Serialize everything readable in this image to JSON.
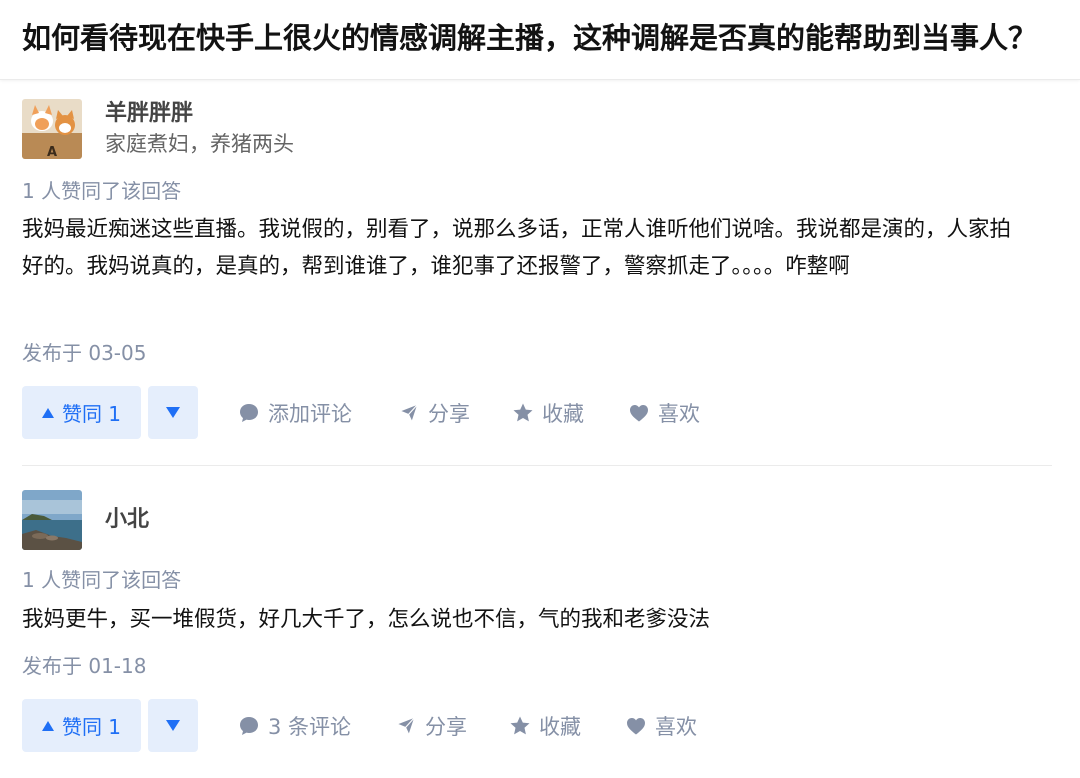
{
  "question": {
    "title": "如何看待现在快手上很火的情感调解主播，这种调解是否真的能帮助到当事人？"
  },
  "answers": [
    {
      "author_name": "羊胖胖胖",
      "author_bio": "家庭煮妇，养猪两头",
      "avatar_letter": "A",
      "vote_text": "1 人赞同了该回答",
      "content": "我妈最近痴迷这些直播。我说假的，别看了，说那么多话，正常人谁听他们说啥。我说都是演的，人家拍好的。我妈说真的，是真的，帮到谁谁了，谁犯事了还报警了，警察抓走了。。。。咋整啊",
      "date": "发布于 03-05",
      "upvote_label": "赞同 1",
      "comment_label": "添加评论",
      "share_label": "分享",
      "collect_label": "收藏",
      "like_label": "喜欢"
    },
    {
      "author_name": "小北",
      "vote_text": "1 人赞同了该回答",
      "content": "我妈更牛，买一堆假货，好几大千了，怎么说也不信，气的我和老爹没法",
      "date": "发布于 01-18",
      "upvote_label": "赞同 1",
      "comment_label": "3 条评论",
      "share_label": "分享",
      "collect_label": "收藏",
      "like_label": "喜欢"
    }
  ],
  "colors": {
    "accent": "#1f6ff5",
    "accent_bg": "#e5eefc",
    "meta_text": "#8590a6"
  },
  "icons": [
    "upvote-triangle-icon",
    "downvote-triangle-icon",
    "comment-bubble-icon",
    "paper-plane-icon",
    "star-icon",
    "heart-icon"
  ]
}
